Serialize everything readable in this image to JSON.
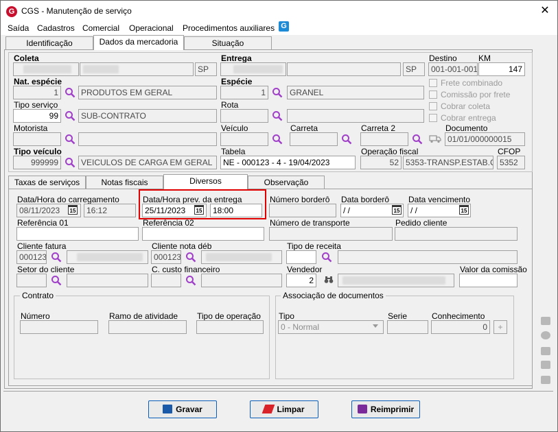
{
  "window": {
    "title": "CGS - Manutenção de serviço",
    "logo_letter": "G",
    "close_glyph": "✕"
  },
  "menu": [
    "Saída",
    "Cadastros",
    "Comercial",
    "Operacional",
    "Procedimentos auxiliares"
  ],
  "menu_icon_letter": "G",
  "top_tabs": [
    "Identificação",
    "Dados da mercadoria",
    "Situação"
  ],
  "top_active_tab": "Dados da mercadoria",
  "form": {
    "coleta": {
      "label": "Coleta",
      "uf": "SP"
    },
    "entrega": {
      "label": "Entrega",
      "uf": "SP"
    },
    "destino": {
      "label": "Destino",
      "value": "001-001-001"
    },
    "km": {
      "label": "KM",
      "value": "147"
    },
    "nat_especie": {
      "label": "Nat. espécie",
      "code": "1",
      "desc": "PRODUTOS EM GERAL"
    },
    "especie": {
      "label": "Espécie",
      "code": "1",
      "desc": "GRANEL"
    },
    "checks": [
      "Frete combinado",
      "Comissão por frete",
      "Cobrar coleta",
      "Cobrar entrega"
    ],
    "tipo_servico": {
      "label": "Tipo serviço",
      "code": "99",
      "desc": "SUB-CONTRATO"
    },
    "rota": {
      "label": "Rota"
    },
    "motorista": {
      "label": "Motorista"
    },
    "veiculo": {
      "label": "Veículo"
    },
    "carreta": {
      "label": "Carreta"
    },
    "carreta2": {
      "label": "Carreta 2"
    },
    "documento": {
      "label": "Documento",
      "value": "01/01/000000015"
    },
    "tipo_veiculo": {
      "label": "Tipo veículo",
      "code": "999999",
      "desc": "VEICULOS DE CARGA EM GERAL"
    },
    "tabela": {
      "label": "Tabela",
      "value": "NE - 000123 - 4 - 19/04/2023"
    },
    "operacao_fiscal": {
      "label": "Operação fiscal",
      "code": "52",
      "desc": "5353-TRANSP.ESTAB.CO"
    },
    "cfop": {
      "label": "CFOP",
      "value": "5352"
    }
  },
  "sub_tabs": [
    "Taxas de serviços",
    "Notas fiscais",
    "Diversos",
    "Observação"
  ],
  "sub_active_tab": "Diversos",
  "diversos": {
    "data_carregamento": {
      "label": "Data/Hora do carregamento",
      "date": "08/11/2023",
      "time": "16:12"
    },
    "data_prev_entrega": {
      "label": "Data/Hora prev. da entrega",
      "date": "25/11/2023",
      "time": "18:00"
    },
    "numero_bordero": {
      "label": "Número borderô"
    },
    "data_bordero": {
      "label": "Data borderô",
      "value": " /  / "
    },
    "data_vencimento": {
      "label": "Data vencimento",
      "value": " /  / "
    },
    "cal_label": "15",
    "referencia01": {
      "label": "Referência 01"
    },
    "referencia02": {
      "label": "Referência 02"
    },
    "numero_transporte": {
      "label": "Número de transporte"
    },
    "pedido_cliente": {
      "label": "Pedido cliente"
    },
    "cliente_fatura": {
      "label": "Cliente fatura",
      "code": "000123"
    },
    "cliente_nota_deb": {
      "label": "Cliente nota déb",
      "code": "000123"
    },
    "tipo_receita": {
      "label": "Tipo de receita"
    },
    "setor_cliente": {
      "label": "Setor do cliente"
    },
    "centro_custo": {
      "label": "C. custo financeiro"
    },
    "vendedor": {
      "label": "Vendedor",
      "value": "2"
    },
    "valor_comissao": {
      "label": "Valor da comissão"
    },
    "contrato": {
      "title": "Contrato",
      "numero": "Número",
      "ramo": "Ramo de atividade",
      "tipo_operacao": "Tipo de operação"
    },
    "assoc_docs": {
      "title": "Associação de documentos",
      "tipo_label": "Tipo",
      "tipo_value": "0 - Normal",
      "serie_label": "Serie",
      "conhecimento_label": "Conhecimento",
      "conhecimento_value": "0",
      "add_glyph": "+"
    }
  },
  "buttons": {
    "gravar": "Gravar",
    "limpar": "Limpar",
    "reimprimir": "Reimprimir"
  },
  "colors": {
    "highlight": "#e00000",
    "button_border": "#0a5db8",
    "logo": "#c8102e",
    "icon_blue": "#1e8bd6",
    "magnifier": "#a040c8"
  }
}
